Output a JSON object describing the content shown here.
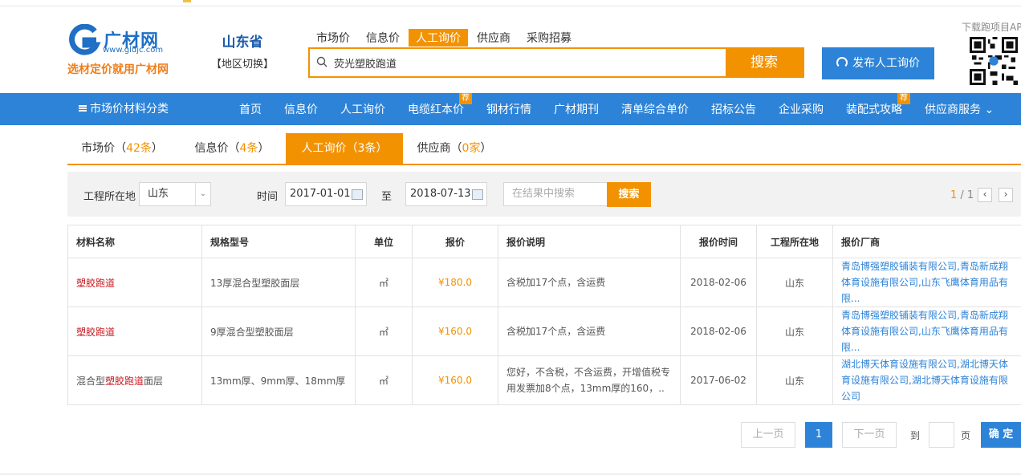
{
  "header": {
    "logo_brand": "广材网",
    "logo_url": "www.gldjc.com",
    "slogan": "选材定价就用广材网",
    "province": "山东省",
    "region_switch": "【地区切换】",
    "search_tabs": [
      "市场价",
      "信息价",
      "人工询价",
      "供应商",
      "采购招募"
    ],
    "search_tab_active": 2,
    "search_value": "荧光塑胶跑道",
    "search_button": "搜索",
    "publish_button": "发布人工询价",
    "download_text": "下载跑项目APP"
  },
  "nav": {
    "category": "市场价材料分类",
    "items": [
      "首页",
      "信息价",
      "人工询价",
      "电缆红本价",
      "钢材行情",
      "广材期刊",
      "清单综合单价",
      "招标公告",
      "企业采购",
      "装配式攻略",
      "供应商服务"
    ],
    "badge": "荐"
  },
  "result_tabs": [
    {
      "label": "市场价（",
      "count": "42条",
      "end": "）"
    },
    {
      "label": "信息价（",
      "count": "4条",
      "end": "）"
    },
    {
      "label": "人工询价（",
      "count": "3条",
      "end": "）"
    },
    {
      "label": "供应商（",
      "count": "0家",
      "end": "）"
    }
  ],
  "result_tab_active": 2,
  "filter": {
    "location_label": "工程所在地",
    "location_value": "山东",
    "time_label": "时间",
    "date_from": "2017-01-01",
    "to_label": "至",
    "date_to": "2018-07-13",
    "search_placeholder": "在结果中搜索",
    "search_button": "搜索",
    "page_current": "1",
    "page_total": " / 1",
    "prev_icon": "‹",
    "next_icon": "›"
  },
  "table": {
    "headers": [
      "材料名称",
      "规格型号",
      "单位",
      "报价",
      "报价说明",
      "报价时间",
      "工程所在地",
      "报价厂商"
    ],
    "rows": [
      {
        "name_pre": "",
        "name_hl": "塑胶跑道",
        "name_post": "",
        "spec": "13厚混合型塑胶面层",
        "unit": "㎡",
        "price": "¥180.0",
        "desc": "含税加17个点，含运费",
        "date": "2018-02-06",
        "location": "山东",
        "vendor": "青岛博强塑胶铺装有限公司,青岛新成翔体育设施有限公司,山东飞鹰体育用品有限..."
      },
      {
        "name_pre": "",
        "name_hl": "塑胶跑道",
        "name_post": "",
        "spec": "9厚混合型塑胶面层",
        "unit": "㎡",
        "price": "¥160.0",
        "desc": "含税加17个点，含运费",
        "date": "2018-02-06",
        "location": "山东",
        "vendor": "青岛博强塑胶铺装有限公司,青岛新成翔体育设施有限公司,山东飞鹰体育用品有限..."
      },
      {
        "name_pre": "混合型",
        "name_hl": "塑胶跑道",
        "name_post": "面层",
        "spec": "13mm厚、9mm厚、18mm厚",
        "unit": "㎡",
        "price": "¥160.0",
        "desc": "您好，不含税，不含运费，开增值税专用发票加8个点，13mm厚的160，..",
        "date": "2017-06-02",
        "location": "山东",
        "vendor": "湖北博天体育设施有限公司,湖北博天体育设施有限公司,湖北博天体育设施有限公司"
      }
    ]
  },
  "pager": {
    "prev": "上一页",
    "current": "1",
    "next": "下一页",
    "to": "到",
    "page_unit": "页",
    "confirm": "确 定"
  },
  "colors": {
    "accent": "#f39200",
    "brand": "#2d83d7",
    "highlight": "#c9171e"
  }
}
